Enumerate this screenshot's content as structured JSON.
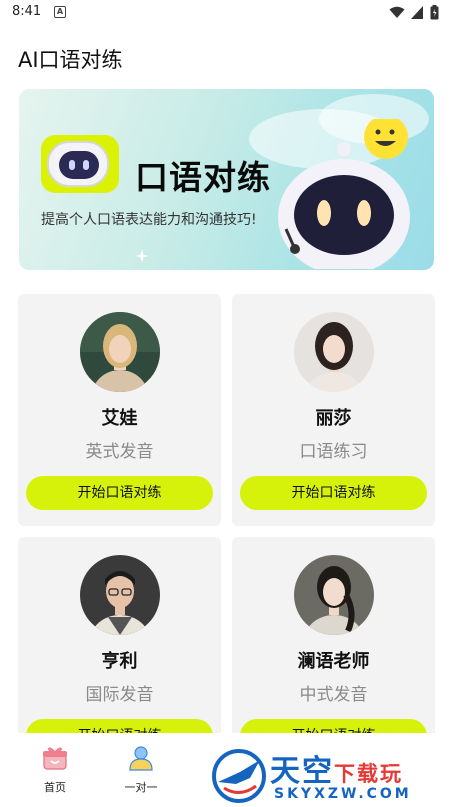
{
  "status_bar": {
    "time": "8:41",
    "indicator": "A"
  },
  "app": {
    "title": "AI口语对练"
  },
  "banner": {
    "title": "口语对练",
    "subtitle": "提高个人口语表达能力和沟通技巧!"
  },
  "tutors": [
    {
      "name": "艾娃",
      "subtitle": "英式发音",
      "button": "开始口语对练"
    },
    {
      "name": "丽莎",
      "subtitle": "口语练习",
      "button": "开始口语对练"
    },
    {
      "name": "亨利",
      "subtitle": "国际发音",
      "button": "开始口语对练"
    },
    {
      "name": "澜语老师",
      "subtitle": "中式发音",
      "button": "开始口语对练"
    }
  ],
  "nav": {
    "items": [
      {
        "label": "首页",
        "icon": "gift-icon"
      },
      {
        "label": "一对一",
        "icon": "person-icon"
      }
    ]
  },
  "watermark": {
    "main": "天空",
    "accent": "下载玩",
    "domain": "SKYXZW.COM"
  },
  "colors": {
    "accent": "#d6f20a",
    "card_bg": "#f3f3f3",
    "watermark_blue": "#1565c0"
  }
}
